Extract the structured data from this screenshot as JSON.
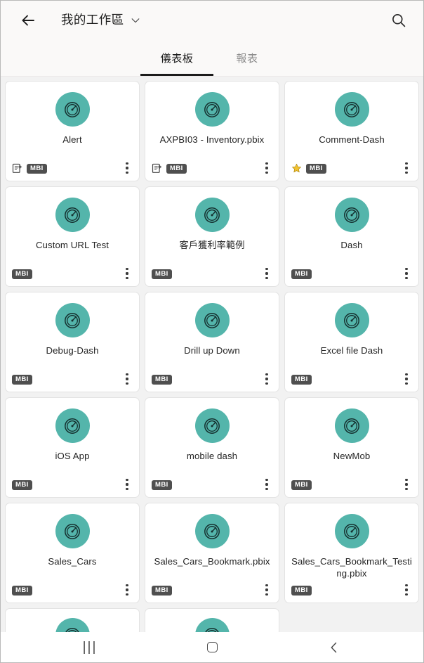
{
  "header": {
    "back_icon": "arrow-left-icon",
    "workspace_title": "我的工作區",
    "chevron_icon": "chevron-down-icon",
    "search_icon": "search-icon"
  },
  "tabs": [
    {
      "label": "儀表板",
      "active": true
    },
    {
      "label": "報表",
      "active": false
    }
  ],
  "colors": {
    "accent_teal": "#54b5ab",
    "badge_gray": "#4f4f4f",
    "star_gold": "#f2c230",
    "header_bg": "#faf9f8",
    "page_bg": "#f2f2f2",
    "card_bg": "#ffffff",
    "active_tab": "#1b1b1b",
    "inactive_tab": "#8c8c8c"
  },
  "badges": {
    "mbi_label": "MBI",
    "shared_icon": "shared-dashboard-icon",
    "favorite_icon": "star-icon",
    "kebab_icon": "more-vertical-icon",
    "dashboard_icon": "gauge-icon"
  },
  "dashboards": [
    {
      "title": "Alert",
      "mbi": "MBI",
      "shared": true,
      "favorite": false
    },
    {
      "title": "AXPBI03 - Inventory.pbix",
      "mbi": "MBI",
      "shared": true,
      "favorite": false
    },
    {
      "title": "Comment-Dash",
      "mbi": "MBI",
      "shared": false,
      "favorite": true
    },
    {
      "title": "Custom URL Test",
      "mbi": "MBI",
      "shared": false,
      "favorite": false
    },
    {
      "title": "客戶獲利率範例",
      "mbi": "MBI",
      "shared": false,
      "favorite": false
    },
    {
      "title": "Dash",
      "mbi": "MBI",
      "shared": false,
      "favorite": false
    },
    {
      "title": "Debug-Dash",
      "mbi": "MBI",
      "shared": false,
      "favorite": false
    },
    {
      "title": "Drill up Down",
      "mbi": "MBI",
      "shared": false,
      "favorite": false
    },
    {
      "title": "Excel file Dash",
      "mbi": "MBI",
      "shared": false,
      "favorite": false
    },
    {
      "title": "iOS App",
      "mbi": "MBI",
      "shared": false,
      "favorite": false
    },
    {
      "title": "mobile dash",
      "mbi": "MBI",
      "shared": false,
      "favorite": false
    },
    {
      "title": "NewMob",
      "mbi": "MBI",
      "shared": false,
      "favorite": false
    },
    {
      "title": "Sales_Cars",
      "mbi": "MBI",
      "shared": false,
      "favorite": false
    },
    {
      "title": "Sales_Cars_Bookmark.pbix",
      "mbi": "MBI",
      "shared": false,
      "favorite": false
    },
    {
      "title": "Sales_Cars_Bookmark_Testing.pbix",
      "mbi": "MBI",
      "shared": false,
      "favorite": false
    }
  ],
  "partial_row_count": 2,
  "navbar": {
    "recents_glyph": "|||",
    "recents_icon": "recents-icon",
    "home_icon": "home-icon",
    "back_glyph": "‹",
    "back_icon": "back-icon"
  }
}
